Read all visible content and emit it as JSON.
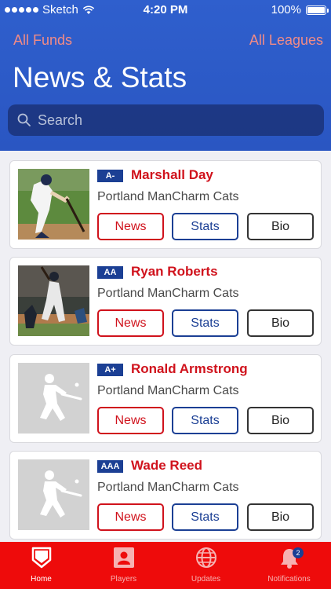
{
  "status_bar": {
    "carrier": "Sketch",
    "time": "4:20 PM",
    "battery": "100%"
  },
  "header": {
    "left_link": "All Funds",
    "right_link": "All Leagues",
    "title": "News & Stats",
    "search_placeholder": "Search"
  },
  "players": [
    {
      "level": "A-",
      "name": "Marshall Day",
      "team": "Portland ManCharm Cats",
      "news": "News",
      "stats": "Stats",
      "bio": "Bio"
    },
    {
      "level": "AA",
      "name": "Ryan Roberts",
      "team": "Portland ManCharm Cats",
      "news": "News",
      "stats": "Stats",
      "bio": "Bio"
    },
    {
      "level": "A+",
      "name": "Ronald Armstrong",
      "team": "Portland ManCharm Cats",
      "news": "News",
      "stats": "Stats",
      "bio": "Bio"
    },
    {
      "level": "AAA",
      "name": "Wade Reed",
      "team": "Portland ManCharm Cats",
      "news": "News",
      "stats": "Stats",
      "bio": "Bio"
    }
  ],
  "tabs": [
    {
      "label": "Home",
      "icon": "home-plate-icon"
    },
    {
      "label": "Players",
      "icon": "player-card-icon"
    },
    {
      "label": "Updates",
      "icon": "globe-icon"
    },
    {
      "label": "Notifications",
      "icon": "bell-icon",
      "badge": "2"
    }
  ],
  "colors": {
    "header_blue": "#2f5fcd",
    "accent_red": "#d0121c",
    "navy": "#1b3f94",
    "tabbar_red": "#ee0b0b",
    "link_pink": "#f28b86"
  }
}
